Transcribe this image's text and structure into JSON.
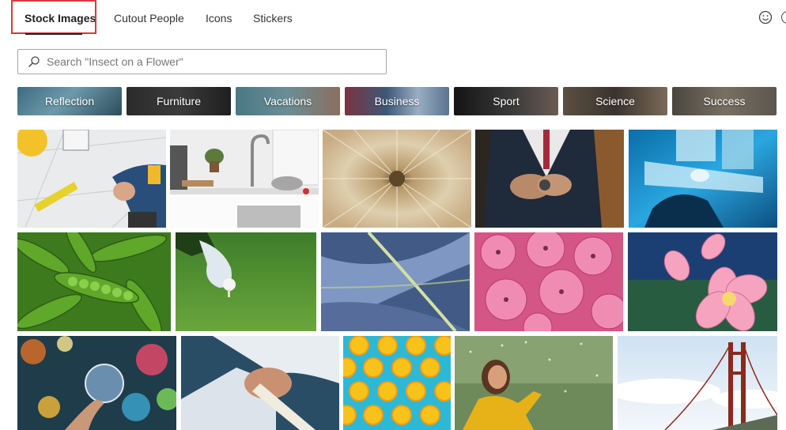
{
  "tabs": [
    {
      "label": "Stock Images",
      "active": true
    },
    {
      "label": "Cutout People",
      "active": false
    },
    {
      "label": "Icons",
      "active": false
    },
    {
      "label": "Stickers",
      "active": false
    }
  ],
  "top_right_icons": [
    "smiley-icon"
  ],
  "search": {
    "placeholder": "Search \"Insect on a Flower\"",
    "value": ""
  },
  "categories": [
    {
      "label": "Reflection"
    },
    {
      "label": "Furniture"
    },
    {
      "label": "Vacations"
    },
    {
      "label": "Business"
    },
    {
      "label": "Sport"
    },
    {
      "label": "Science"
    },
    {
      "label": "Success"
    }
  ],
  "colors": {
    "highlight_border": "#d9393e",
    "search_border": "#a6a6a6",
    "placeholder": "#767676"
  }
}
